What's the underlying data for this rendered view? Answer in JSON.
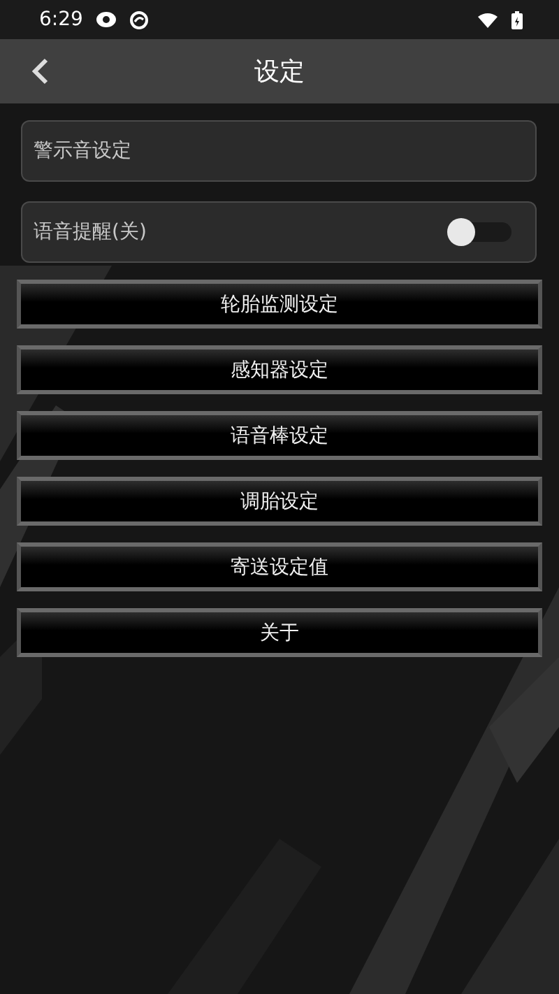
{
  "status_bar": {
    "time": "6:29"
  },
  "toolbar": {
    "title": "设定"
  },
  "settings": [
    {
      "kind": "item",
      "label": "警示音设定"
    },
    {
      "kind": "toggle",
      "label": "语音提醒(关)",
      "on": false
    }
  ],
  "menu_buttons": [
    "轮胎监测设定",
    "感知器设定",
    "语音棒设定",
    "调胎设定",
    "寄送设定值",
    "关于"
  ]
}
